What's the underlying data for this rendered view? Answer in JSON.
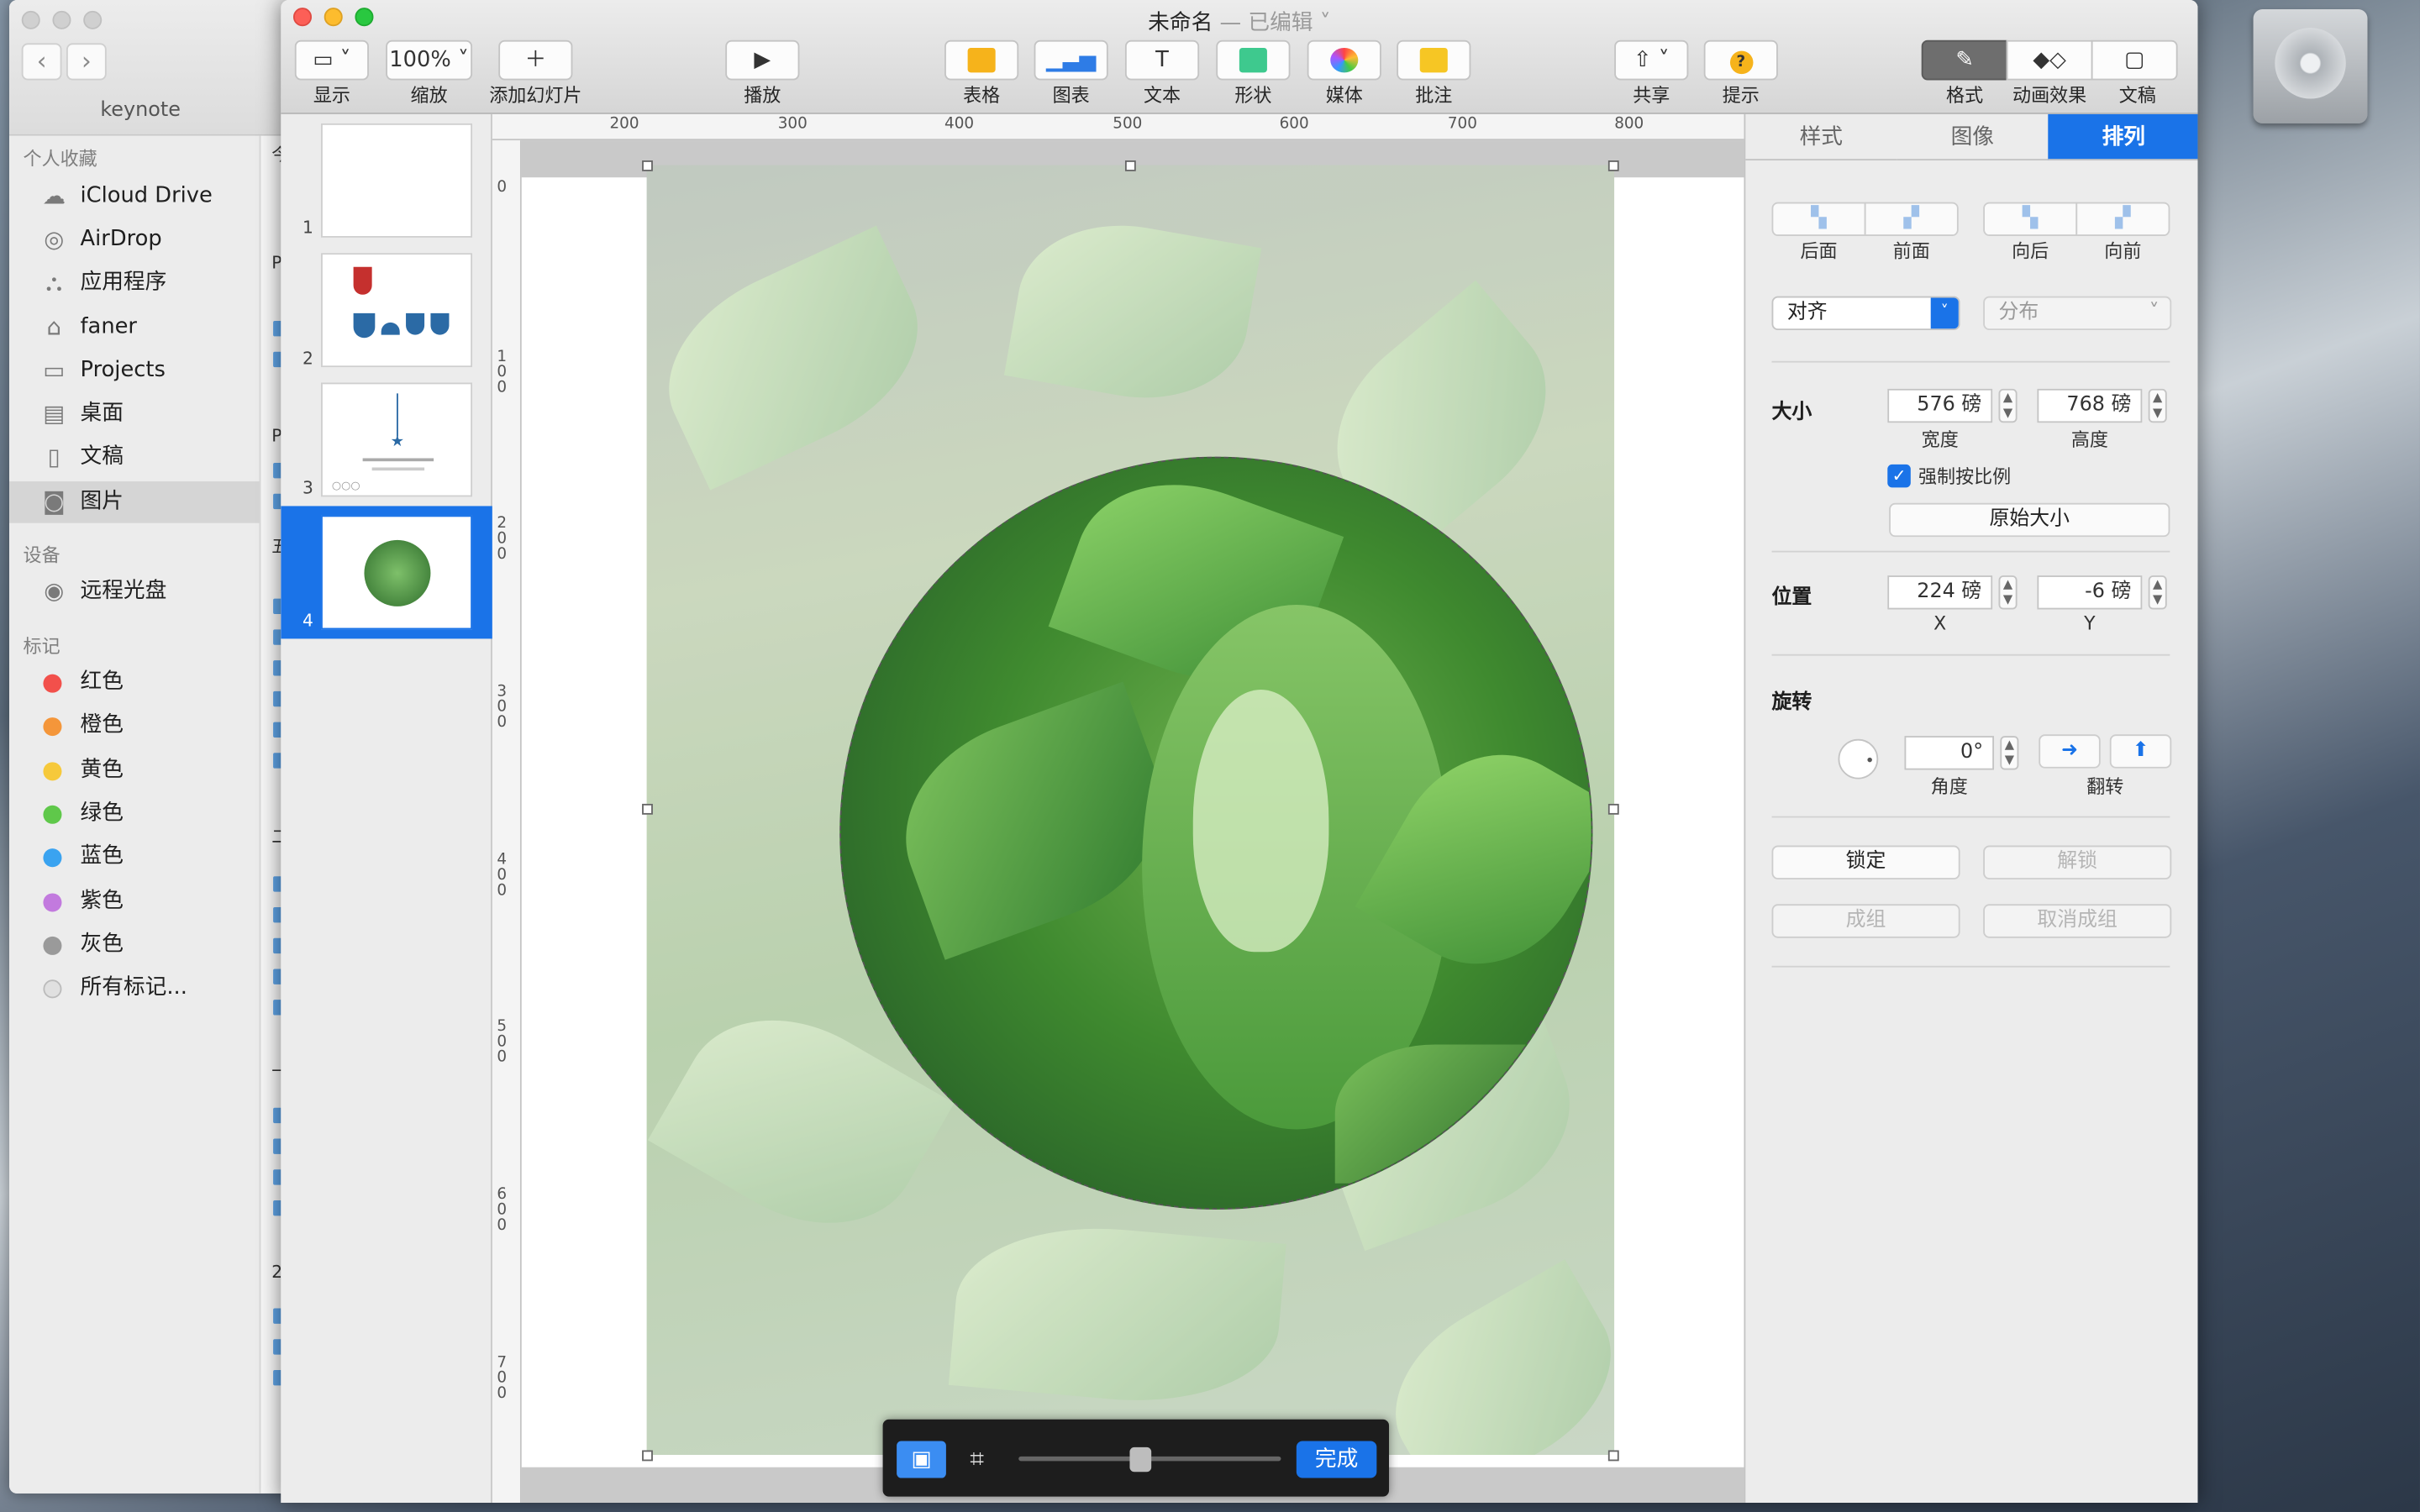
{
  "finder": {
    "window_title": "keynote",
    "sidebar_header_favorites": "个人收藏",
    "favorites": [
      {
        "label": "iCloud Drive",
        "icon": "cloud-icon"
      },
      {
        "label": "AirDrop",
        "icon": "airdrop-icon"
      },
      {
        "label": "应用程序",
        "icon": "applications-icon"
      },
      {
        "label": "faner",
        "icon": "home-icon"
      },
      {
        "label": "Projects",
        "icon": "folder-icon"
      },
      {
        "label": "桌面",
        "icon": "desktop-icon"
      },
      {
        "label": "文稿",
        "icon": "documents-icon"
      },
      {
        "label": "图片",
        "icon": "camera-icon"
      }
    ],
    "sidebar_header_devices": "设备",
    "devices": [
      {
        "label": "远程光盘",
        "icon": "disc-icon"
      }
    ],
    "sidebar_header_tags": "标记",
    "tags": [
      {
        "label": "红色",
        "color": "#f2504b"
      },
      {
        "label": "橙色",
        "color": "#f4963a"
      },
      {
        "label": "黄色",
        "color": "#f6c93b"
      },
      {
        "label": "绿色",
        "color": "#5fc84a"
      },
      {
        "label": "蓝色",
        "color": "#3aa3f0"
      },
      {
        "label": "紫色",
        "color": "#c27ade"
      },
      {
        "label": "灰色",
        "color": "#9a9a9a"
      },
      {
        "label": "所有标记...",
        "color": "#e0e0e0"
      }
    ],
    "strip_chars": [
      "今",
      "P",
      "P",
      "五",
      "二",
      "一",
      "2"
    ]
  },
  "keynote": {
    "title": "未命名",
    "title_status": "— 已编辑",
    "toolbar": {
      "view": "显示",
      "zoom_value": "100%",
      "zoom": "缩放",
      "add_slide": "添加幻灯片",
      "play": "播放",
      "table": "表格",
      "chart": "图表",
      "text": "文本",
      "shape": "形状",
      "media": "媒体",
      "comment": "批注",
      "share": "共享",
      "tips": "提示",
      "format": "格式",
      "animate": "动画效果",
      "document": "文稿"
    },
    "slides": [
      "1",
      "2",
      "3",
      "4"
    ],
    "selected_slide": "4",
    "ruler_h": [
      "200",
      "300",
      "400",
      "500",
      "600",
      "700",
      "800"
    ],
    "ruler_v": [
      "0",
      "100",
      "200",
      "300",
      "400",
      "500",
      "600",
      "700"
    ],
    "mask_bar": {
      "done": "完成",
      "mask_level": 0.46
    },
    "inspector": {
      "tabs": [
        "样式",
        "图像",
        "排列"
      ],
      "active_tab": "排列",
      "layer_buttons": [
        "后面",
        "前面",
        "向后",
        "向前"
      ],
      "align": "对齐",
      "distribute": "分布",
      "size_label": "大小",
      "width_value": "576 磅",
      "width_label": "宽度",
      "height_value": "768 磅",
      "height_label": "高度",
      "constrain": "强制按比例",
      "original_size": "原始大小",
      "position_label": "位置",
      "x_value": "224 磅",
      "x_label": "X",
      "y_value": "-6 磅",
      "y_label": "Y",
      "rotate_label": "旋转",
      "angle_value": "0°",
      "angle_label": "角度",
      "flip_label": "翻转",
      "lock": "锁定",
      "unlock": "解锁",
      "group": "成组",
      "ungroup": "取消成组"
    }
  }
}
